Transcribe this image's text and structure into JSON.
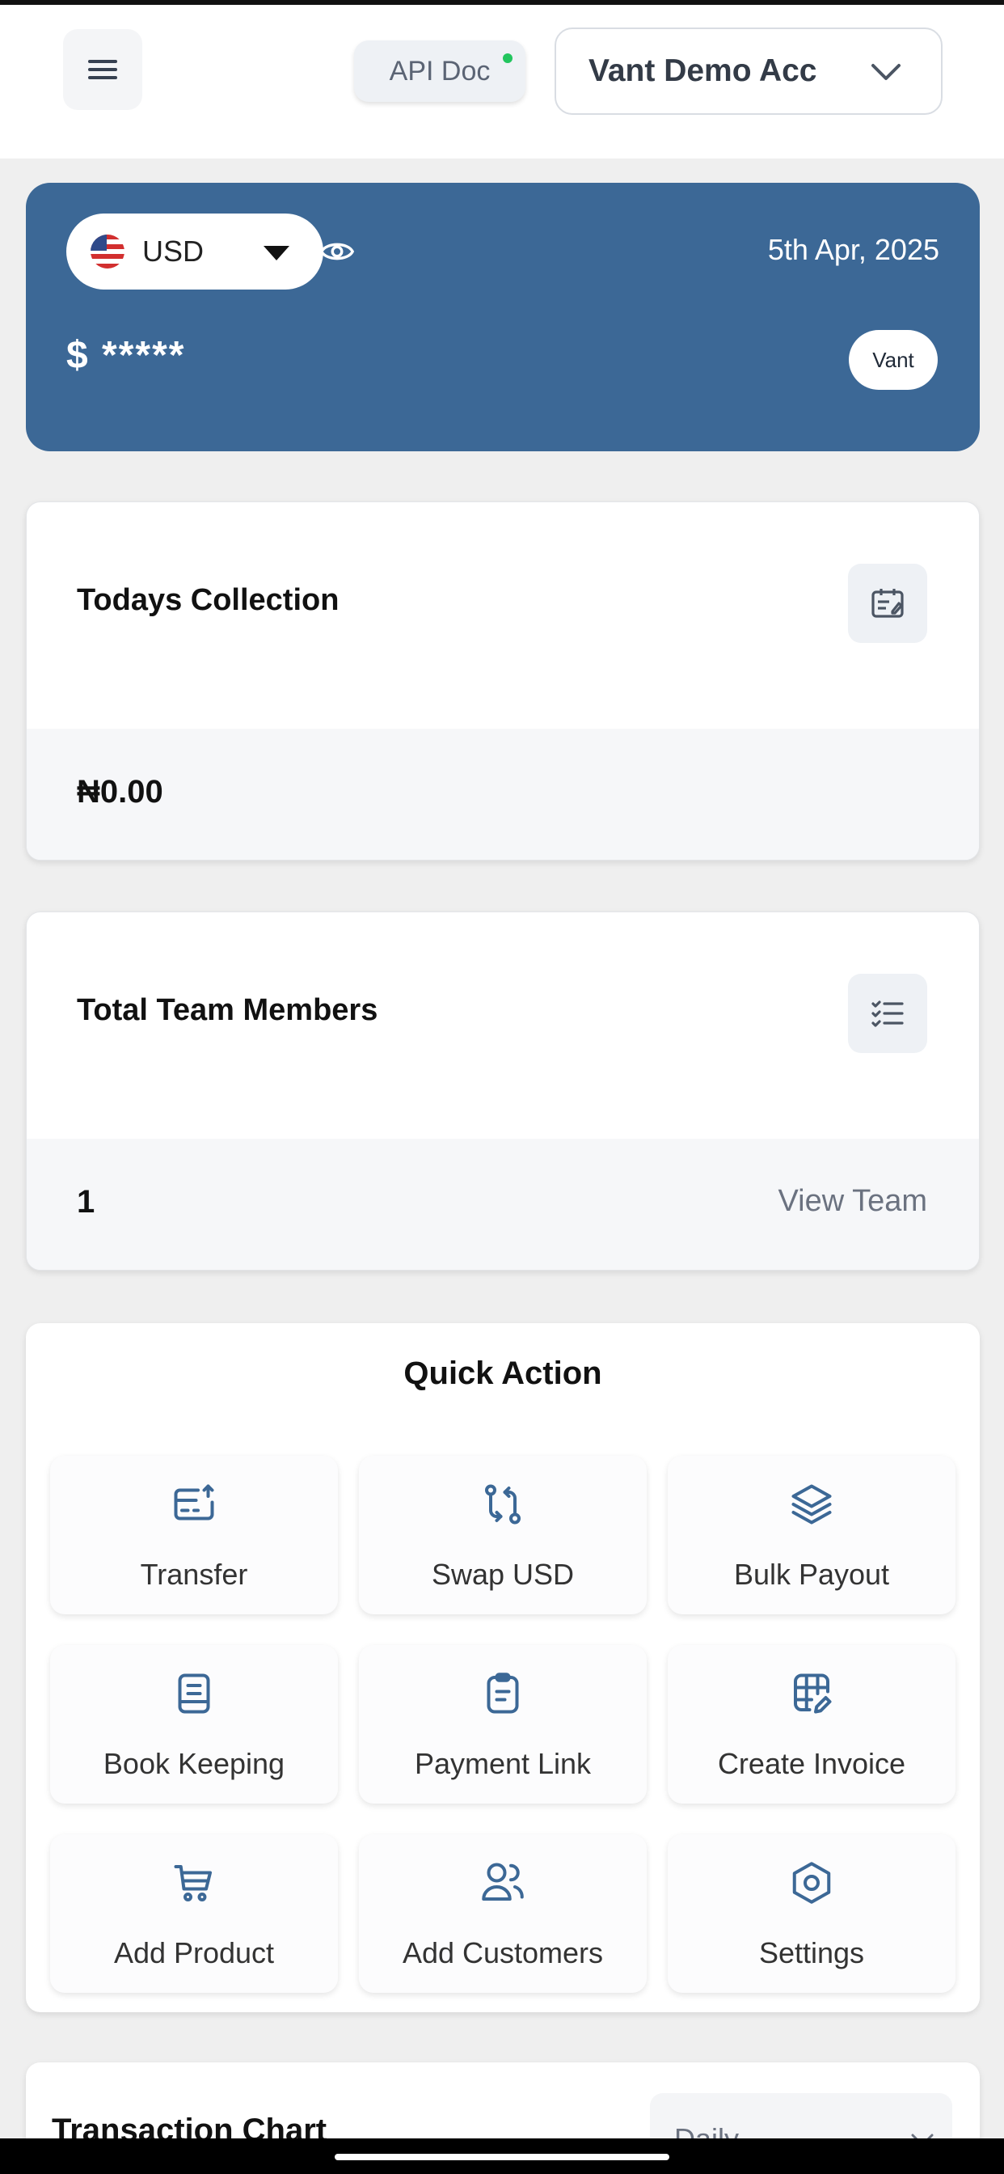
{
  "header": {
    "menu_icon": "hamburger-menu-icon",
    "api_doc_label": "API Doc",
    "api_status_color": "#22c55e",
    "account_name": "Vant Demo Acc"
  },
  "balance_card": {
    "currency": "USD",
    "date": "5th Apr, 2025",
    "balance_masked": "$ *****",
    "brand_badge": "Vant",
    "background_color": "#3c6896"
  },
  "todays_collection": {
    "title": "Todays Collection",
    "value": "₦0.00",
    "icon": "calendar-edit-icon"
  },
  "team_members": {
    "title": "Total Team Members",
    "value": "1",
    "link_label": "View Team",
    "icon": "checklist-icon"
  },
  "quick_action": {
    "title": "Quick Action",
    "actions": [
      {
        "label": "Transfer",
        "icon": "transfer-icon"
      },
      {
        "label": "Swap USD",
        "icon": "swap-icon"
      },
      {
        "label": "Bulk Payout",
        "icon": "layers-icon"
      },
      {
        "label": "Book Keeping",
        "icon": "notebook-icon"
      },
      {
        "label": "Payment Link",
        "icon": "clipboard-icon"
      },
      {
        "label": "Create Invoice",
        "icon": "grid-edit-icon"
      },
      {
        "label": "Add Product",
        "icon": "cart-icon"
      },
      {
        "label": "Add Customers",
        "icon": "users-icon"
      },
      {
        "label": "Settings",
        "icon": "settings-hex-icon"
      }
    ]
  },
  "transaction_chart": {
    "title": "Transaction Chart",
    "period": "Daily"
  }
}
